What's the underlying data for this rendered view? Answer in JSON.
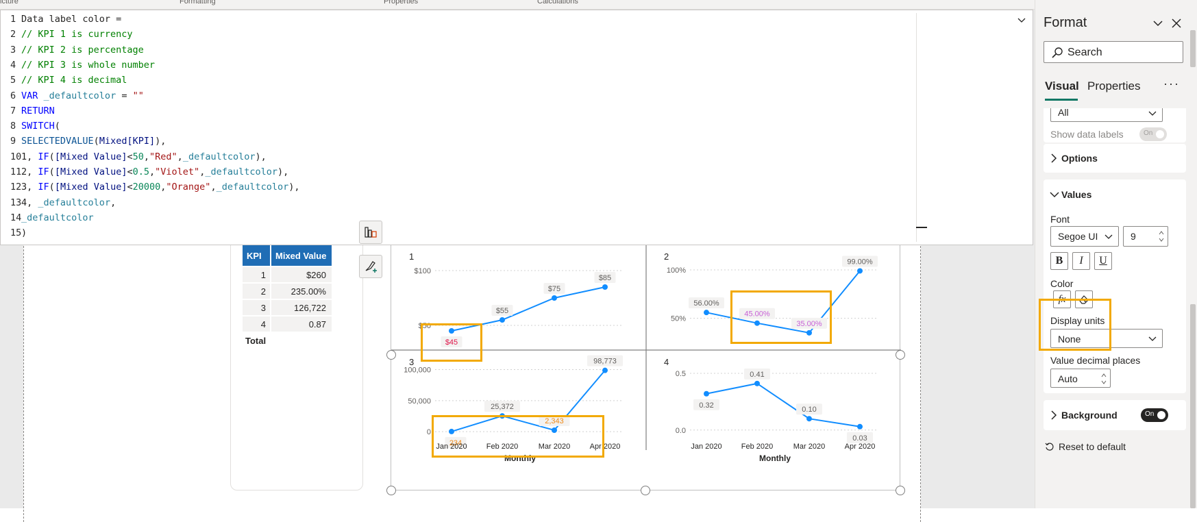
{
  "ribbon": {
    "labels": [
      "icture",
      "Formatting",
      "Properties",
      "Calculations"
    ]
  },
  "dax_editor": {
    "lines": [
      [
        {
          "t": "Data label color =",
          "c": ""
        }
      ],
      [
        {
          "t": "// KPI 1 is currency",
          "c": "cm"
        }
      ],
      [
        {
          "t": "// KPI 2 is percentage",
          "c": "cm"
        }
      ],
      [
        {
          "t": "// KPI 3 is whole number",
          "c": "cm"
        }
      ],
      [
        {
          "t": "// KPI 4 is decimal",
          "c": "cm"
        }
      ],
      [
        {
          "t": "VAR",
          "c": "kw"
        },
        {
          "t": " ",
          "c": ""
        },
        {
          "t": "_defaultcolor",
          "c": "var"
        },
        {
          "t": " = ",
          "c": ""
        },
        {
          "t": "\"\"",
          "c": "str"
        }
      ],
      [
        {
          "t": "RETURN",
          "c": "kw"
        }
      ],
      [
        {
          "t": "SWITCH",
          "c": "kw"
        },
        {
          "t": "(",
          "c": ""
        }
      ],
      [
        {
          "t": "SELECTEDVALUE",
          "c": "fn"
        },
        {
          "t": "(",
          "c": ""
        },
        {
          "t": "Mixed[KPI]",
          "c": "fld"
        },
        {
          "t": "),",
          "c": ""
        }
      ],
      [
        {
          "t": "1",
          "c": ""
        },
        {
          "t": ", ",
          "c": ""
        },
        {
          "t": "IF",
          "c": "kw"
        },
        {
          "t": "(",
          "c": ""
        },
        {
          "t": "[Mixed Value]",
          "c": "fld"
        },
        {
          "t": "<",
          "c": ""
        },
        {
          "t": "50",
          "c": "num"
        },
        {
          "t": ",",
          "c": ""
        },
        {
          "t": "\"Red\"",
          "c": "str"
        },
        {
          "t": ",",
          "c": ""
        },
        {
          "t": "_defaultcolor",
          "c": "var"
        },
        {
          "t": "),",
          "c": ""
        }
      ],
      [
        {
          "t": "2",
          "c": ""
        },
        {
          "t": ", ",
          "c": ""
        },
        {
          "t": "IF",
          "c": "kw"
        },
        {
          "t": "(",
          "c": ""
        },
        {
          "t": "[Mixed Value]",
          "c": "fld"
        },
        {
          "t": "<",
          "c": ""
        },
        {
          "t": "0.5",
          "c": "num"
        },
        {
          "t": ",",
          "c": ""
        },
        {
          "t": "\"Violet\"",
          "c": "str"
        },
        {
          "t": ",",
          "c": ""
        },
        {
          "t": "_defaultcolor",
          "c": "var"
        },
        {
          "t": "),",
          "c": ""
        }
      ],
      [
        {
          "t": "3",
          "c": ""
        },
        {
          "t": ", ",
          "c": ""
        },
        {
          "t": "IF",
          "c": "kw"
        },
        {
          "t": "(",
          "c": ""
        },
        {
          "t": "[Mixed Value]",
          "c": "fld"
        },
        {
          "t": "<",
          "c": ""
        },
        {
          "t": "20000",
          "c": "num"
        },
        {
          "t": ",",
          "c": ""
        },
        {
          "t": "\"Orange\"",
          "c": "str"
        },
        {
          "t": ",",
          "c": ""
        },
        {
          "t": "_defaultcolor",
          "c": "var"
        },
        {
          "t": "),",
          "c": ""
        }
      ],
      [
        {
          "t": "4",
          "c": ""
        },
        {
          "t": ", ",
          "c": ""
        },
        {
          "t": "_defaultcolor",
          "c": "var"
        },
        {
          "t": ",",
          "c": ""
        }
      ],
      [
        {
          "t": "_defaultcolor",
          "c": "var"
        }
      ],
      [
        {
          "t": ")",
          "c": ""
        }
      ]
    ]
  },
  "table_visual": {
    "headers": [
      "KPI",
      "Mixed Value"
    ],
    "rows": [
      {
        "kpi": "1",
        "value": "$260"
      },
      {
        "kpi": "2",
        "value": "235.00%"
      },
      {
        "kpi": "3",
        "value": "126,722"
      },
      {
        "kpi": "4",
        "value": "0.87"
      }
    ],
    "total_label": "Total"
  },
  "chart_data": [
    {
      "type": "line",
      "panel_title": "1",
      "x": [
        "Jan 2020",
        "Feb 2020",
        "Mar 2020",
        "Apr 2020"
      ],
      "values": [
        45,
        55,
        75,
        85
      ],
      "data_labels": [
        "$45",
        "$55",
        "$75",
        "$85"
      ],
      "label_colors": [
        "#e0164a",
        "#605e5c",
        "#605e5c",
        "#605e5c"
      ],
      "y_ticks": [
        "$100",
        "$50"
      ],
      "y_tick_values": [
        100,
        50
      ],
      "ylim": [
        30,
        105
      ],
      "xlabel": "Monthly",
      "show_x_ticks": false
    },
    {
      "type": "line",
      "panel_title": "2",
      "x": [
        "Jan 2020",
        "Feb 2020",
        "Mar 2020",
        "Apr 2020"
      ],
      "values": [
        0.56,
        0.45,
        0.35,
        0.99
      ],
      "data_labels": [
        "56.00%",
        "45.00%",
        "35.00%",
        "99.00%"
      ],
      "label_colors": [
        "#605e5c",
        "#c75fd6",
        "#c75fd6",
        "#605e5c"
      ],
      "y_ticks": [
        "100%",
        "50%"
      ],
      "y_tick_values": [
        1.0,
        0.5
      ],
      "ylim": [
        0.2,
        1.05
      ],
      "xlabel": "Monthly",
      "show_x_ticks": false
    },
    {
      "type": "line",
      "panel_title": "3",
      "x": [
        "Jan 2020",
        "Feb 2020",
        "Mar 2020",
        "Apr 2020"
      ],
      "values": [
        234,
        25372,
        2343,
        98773
      ],
      "data_labels": [
        "234",
        "25,372",
        "2,343",
        "98,773"
      ],
      "label_colors": [
        "#ef8a17",
        "#605e5c",
        "#ef8a17",
        "#605e5c"
      ],
      "y_ticks": [
        "100,000",
        "50,000",
        "0"
      ],
      "y_tick_values": [
        100000,
        50000,
        0
      ],
      "ylim": [
        -12000,
        105000
      ],
      "xlabel": "Monthly",
      "show_x_ticks": true
    },
    {
      "type": "line",
      "panel_title": "4",
      "x": [
        "Jan 2020",
        "Feb 2020",
        "Mar 2020",
        "Apr 2020"
      ],
      "values": [
        0.32,
        0.41,
        0.1,
        0.03
      ],
      "data_labels": [
        "0.32",
        "0.41",
        "0.10",
        "0.03"
      ],
      "label_colors": [
        "#605e5c",
        "#605e5c",
        "#605e5c",
        "#605e5c"
      ],
      "y_ticks": [
        "0.5",
        "0.0"
      ],
      "y_tick_values": [
        0.5,
        0.0
      ],
      "ylim": [
        -0.08,
        0.56
      ],
      "xlabel": "Monthly",
      "show_x_ticks": true
    }
  ],
  "format_pane": {
    "title": "Format",
    "search_placeholder": "Search",
    "tabs": [
      "Visual",
      "Properties"
    ],
    "more": "···",
    "series_value": "All",
    "show_data_labels": "Show data labels",
    "show_data_labels_toggle": "On",
    "options_label": "Options",
    "values_label": "Values",
    "font_label": "Font",
    "font_family": "Segoe UI",
    "font_size": "9",
    "bold": "B",
    "italic": "I",
    "underline": "U",
    "color_label": "Color",
    "fx": "fx",
    "display_units_label": "Display units",
    "display_units_value": "None",
    "decimal_label": "Value decimal places",
    "decimal_value": "Auto",
    "background_label": "Background",
    "background_toggle": "On",
    "reset_label": "Reset to default",
    "accent_color": "#117865",
    "highlight_color": "#f2a900"
  }
}
